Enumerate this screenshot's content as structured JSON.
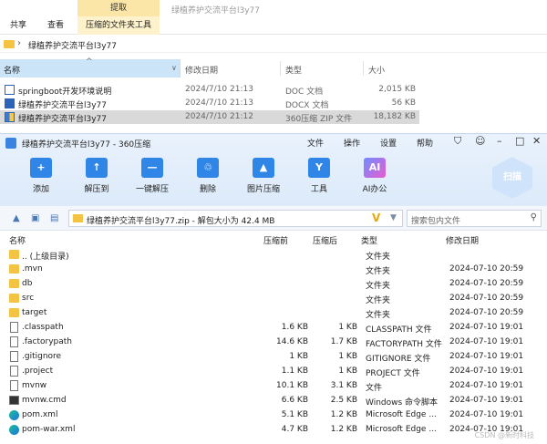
{
  "explorer": {
    "context_header": "提取",
    "window_title": "绿植养护交流平台l3y77",
    "tabs": [
      "共享",
      "查看"
    ],
    "context_tab": "压缩的文件夹工具",
    "address": "绿植养护交流平台l3y77",
    "columns": [
      "名称",
      "修改日期",
      "类型",
      "大小"
    ],
    "rows": [
      {
        "name": "springboot开发环境说明",
        "date": "2024/7/10 21:13",
        "type": "DOC 文档",
        "size": "2,015 KB",
        "icon": "doc-icon"
      },
      {
        "name": "绿植养护交流平台l3y77",
        "date": "2024/7/10 21:13",
        "type": "DOCX 文档",
        "size": "56 KB",
        "icon": "docx-icon"
      },
      {
        "name": "绿植养护交流平台l3y77",
        "date": "2024/7/10 21:12",
        "type": "360压缩 ZIP 文件",
        "size": "18,182 KB",
        "icon": "zip-icon"
      }
    ]
  },
  "zip": {
    "title": "绿植养护交流平台l3y77 - 360压缩",
    "menu": [
      "文件",
      "操作",
      "设置",
      "帮助"
    ],
    "controls": [
      "shirt-icon",
      "feedback-icon",
      "minimize-icon",
      "maximize-icon",
      "close-icon"
    ],
    "toolbar": [
      {
        "label": "添加",
        "icon": "add-icon"
      },
      {
        "label": "解压到",
        "icon": "extract-to-icon"
      },
      {
        "label": "一键解压",
        "icon": "one-click-extract-icon"
      },
      {
        "label": "删除",
        "icon": "delete-icon"
      },
      {
        "label": "图片压缩",
        "icon": "image-compress-icon"
      },
      {
        "label": "工具",
        "icon": "tools-icon"
      },
      {
        "label": "AI办公",
        "icon": "ai-office-icon"
      }
    ],
    "scan_label": "扫描",
    "path": "绿植养护交流平台l3y77.zip - 解包大小为 42.4 MB",
    "search_placeholder": "搜索包内文件",
    "columns": [
      "名称",
      "压缩前",
      "压缩后",
      "类型",
      "修改日期"
    ],
    "rows": [
      {
        "name": ".. (上级目录)",
        "before": "",
        "after": "",
        "type": "文件夹",
        "date": "",
        "kind": "folder"
      },
      {
        "name": ".mvn",
        "before": "",
        "after": "",
        "type": "文件夹",
        "date": "2024-07-10 20:59",
        "kind": "folder"
      },
      {
        "name": "db",
        "before": "",
        "after": "",
        "type": "文件夹",
        "date": "2024-07-10 20:59",
        "kind": "folder"
      },
      {
        "name": "src",
        "before": "",
        "after": "",
        "type": "文件夹",
        "date": "2024-07-10 20:59",
        "kind": "folder"
      },
      {
        "name": "target",
        "before": "",
        "after": "",
        "type": "文件夹",
        "date": "2024-07-10 20:59",
        "kind": "folder"
      },
      {
        "name": ".classpath",
        "before": "1.6 KB",
        "after": "1 KB",
        "type": "CLASSPATH 文件",
        "date": "2024-07-10 19:01",
        "kind": "file"
      },
      {
        "name": ".factorypath",
        "before": "14.6 KB",
        "after": "1.7 KB",
        "type": "FACTORYPATH 文件",
        "date": "2024-07-10 19:01",
        "kind": "file"
      },
      {
        "name": ".gitignore",
        "before": "1 KB",
        "after": "1 KB",
        "type": "GITIGNORE 文件",
        "date": "2024-07-10 19:01",
        "kind": "file"
      },
      {
        "name": ".project",
        "before": "1.1 KB",
        "after": "1 KB",
        "type": "PROJECT 文件",
        "date": "2024-07-10 19:01",
        "kind": "file"
      },
      {
        "name": "mvnw",
        "before": "10.1 KB",
        "after": "3.1 KB",
        "type": "文件",
        "date": "2024-07-10 19:01",
        "kind": "file"
      },
      {
        "name": "mvnw.cmd",
        "before": "6.6 KB",
        "after": "2.5 KB",
        "type": "Windows 命令脚本",
        "date": "2024-07-10 19:01",
        "kind": "cmd"
      },
      {
        "name": "pom.xml",
        "before": "5.1 KB",
        "after": "1.2 KB",
        "type": "Microsoft Edge ...",
        "date": "2024-07-10 19:01",
        "kind": "edge"
      },
      {
        "name": "pom-war.xml",
        "before": "4.7 KB",
        "after": "1.2 KB",
        "type": "Microsoft Edge ...",
        "date": "2024-07-10 19:01",
        "kind": "edge"
      }
    ]
  },
  "watermark": "CSDN @新时科技"
}
